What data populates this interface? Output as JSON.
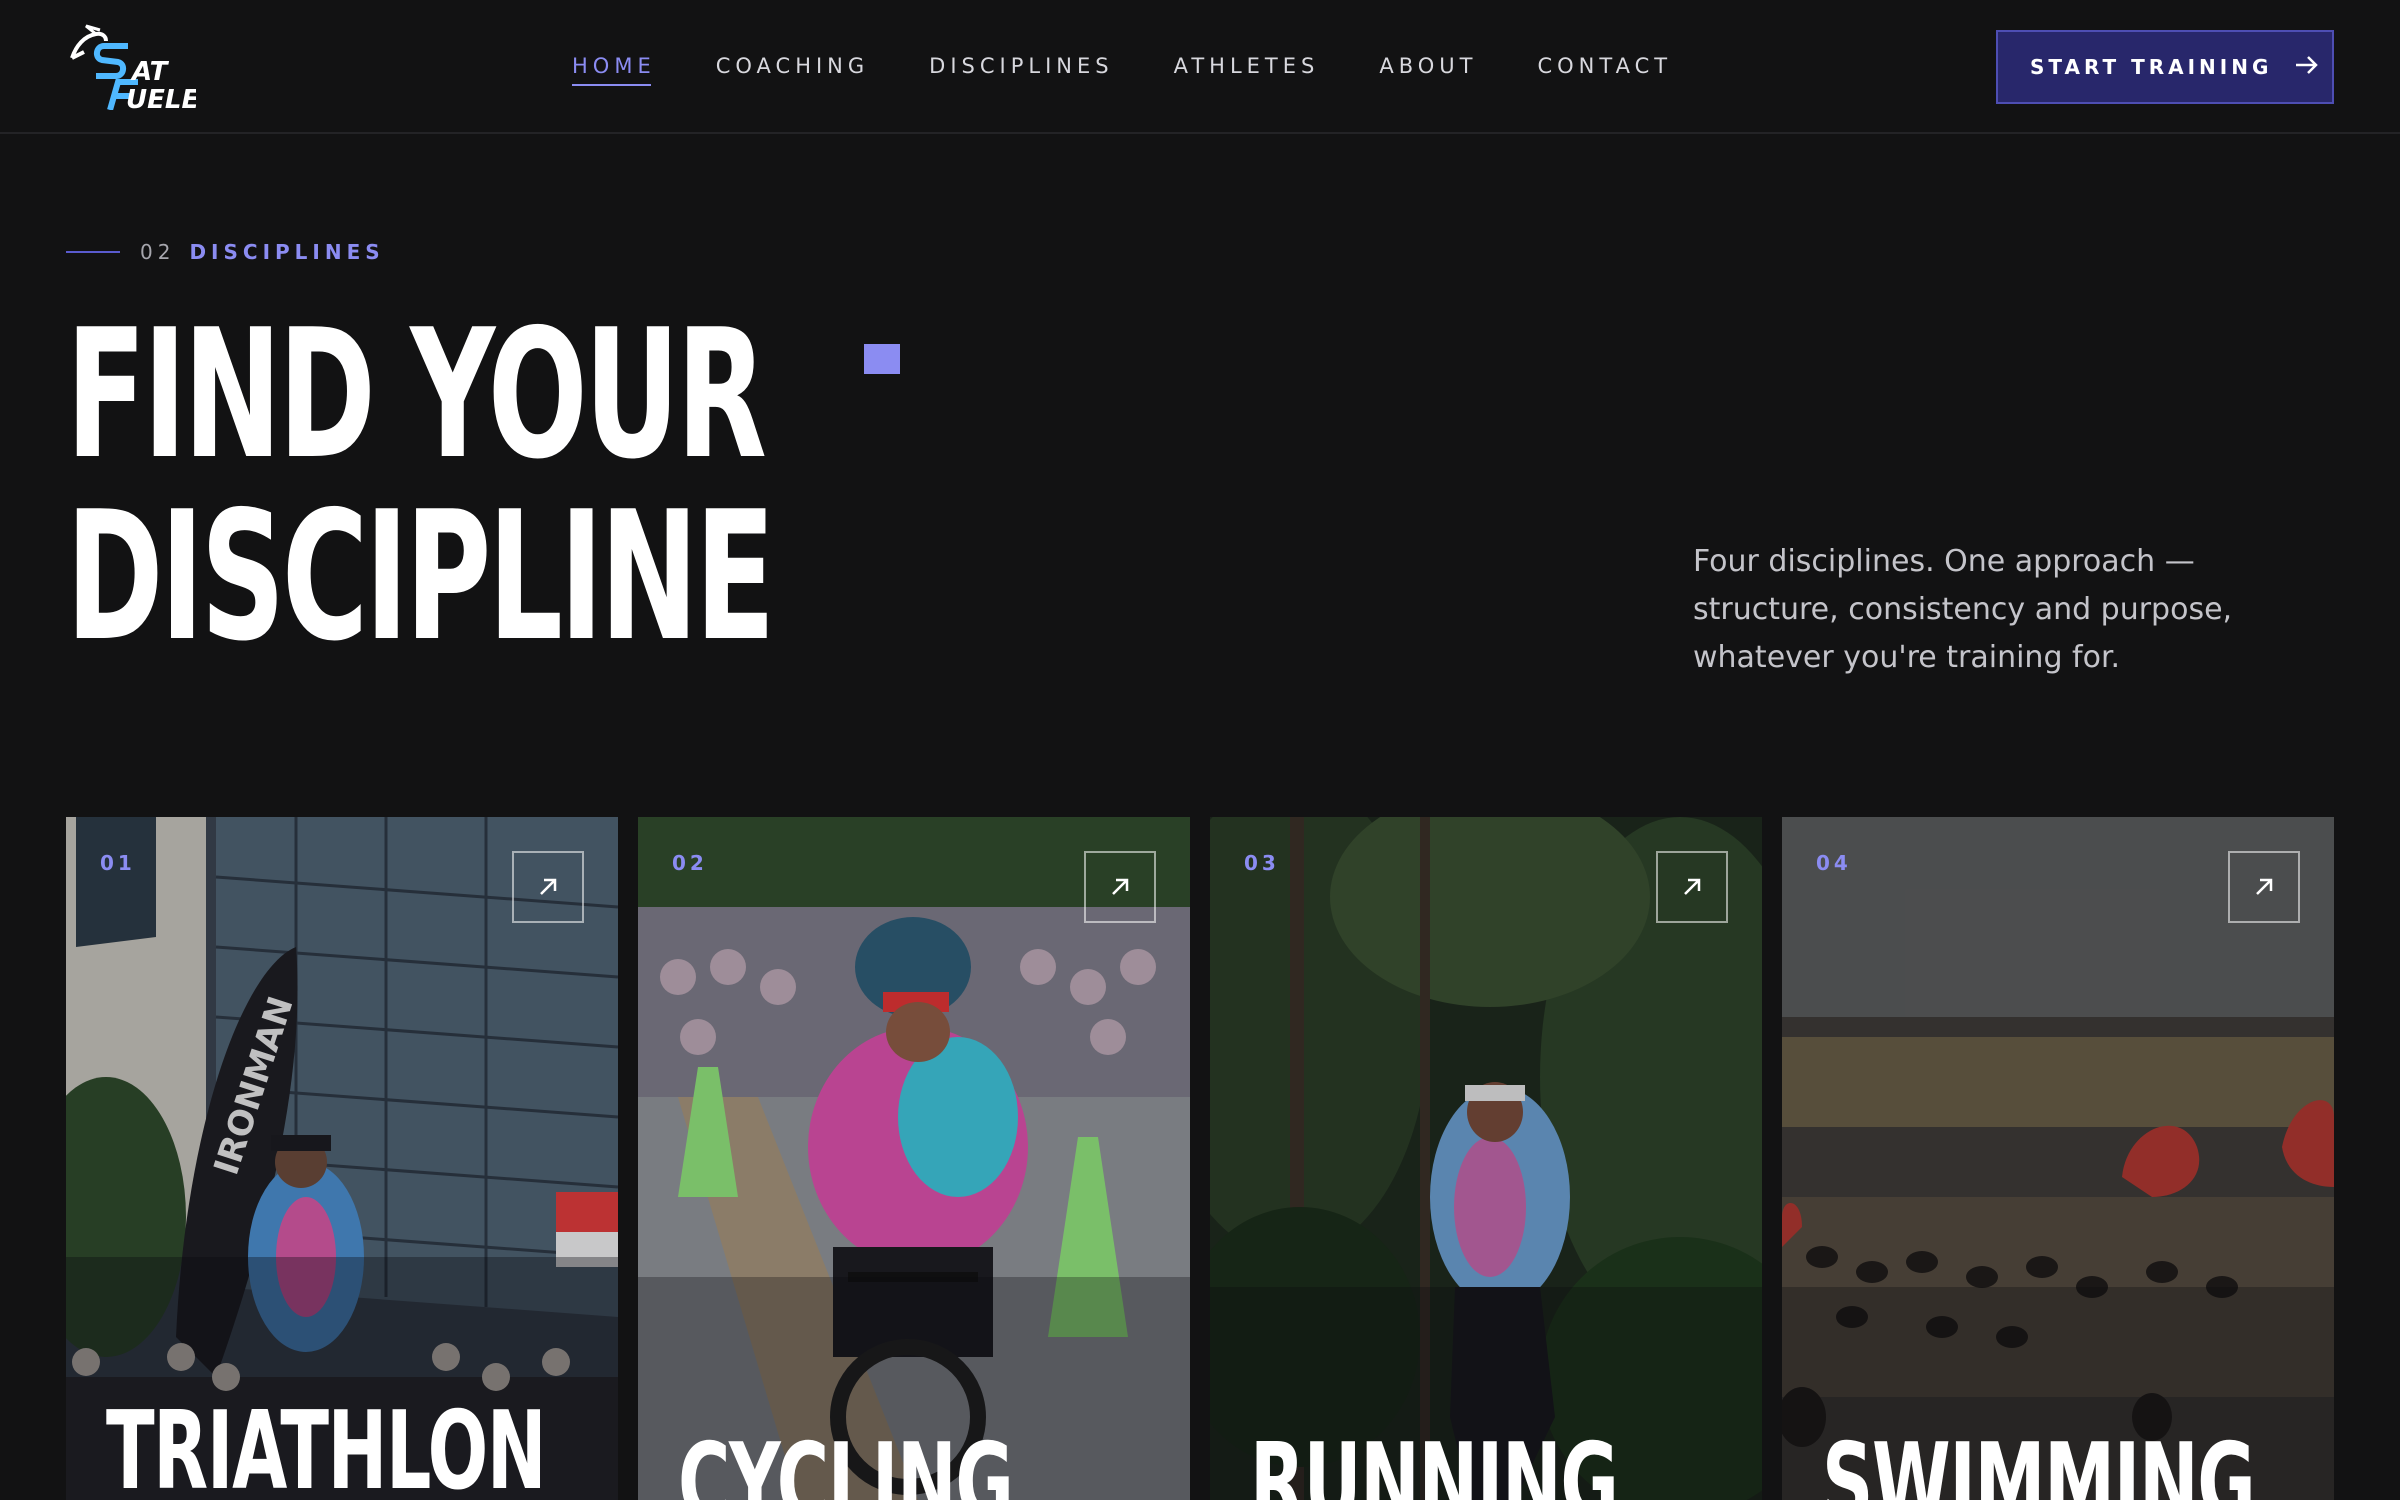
{
  "brand": {
    "name_line1": "AT",
    "name_line2": "UELED",
    "initial1": "S",
    "initial2": "F"
  },
  "nav": {
    "items": [
      {
        "label": "HOME",
        "active": true
      },
      {
        "label": "COACHING",
        "active": false
      },
      {
        "label": "DISCIPLINES",
        "active": false
      },
      {
        "label": "ATHLETES",
        "active": false
      },
      {
        "label": "ABOUT",
        "active": false
      },
      {
        "label": "CONTACT",
        "active": false
      }
    ],
    "cta_label": "START TRAINING",
    "cta_icon": "arrow-right-icon"
  },
  "section": {
    "number": "02",
    "label": "DISCIPLINES",
    "headline_line1": "FIND YOUR",
    "headline_line2": "DISCIPLINE",
    "description": "Four disciplines. One approach — structure, consistency and purpose, whatever you're training for."
  },
  "cards": [
    {
      "number": "01",
      "title": "TRIATHLON",
      "icon": "arrow-up-right-icon"
    },
    {
      "number": "02",
      "title": "CYCLING",
      "icon": "arrow-up-right-icon"
    },
    {
      "number": "03",
      "title": "RUNNING",
      "icon": "arrow-up-right-icon"
    },
    {
      "number": "04",
      "title": "SWIMMING",
      "icon": "arrow-up-right-icon"
    }
  ],
  "colors": {
    "background": "#121213",
    "accent": "#8b8cf2",
    "cta_background": "#28276b",
    "text_muted": "#c4c4ca"
  }
}
